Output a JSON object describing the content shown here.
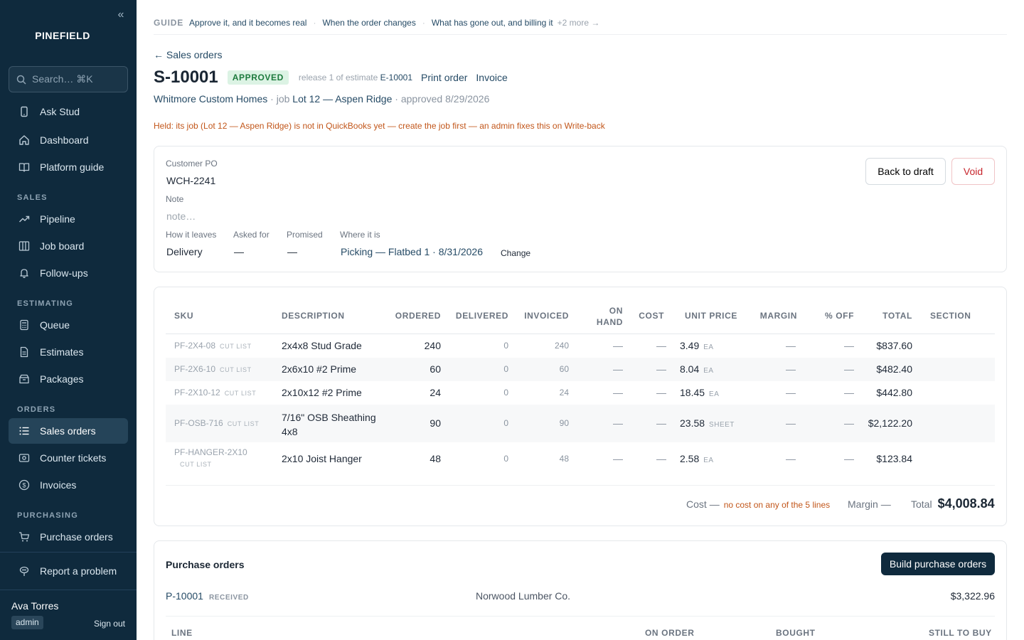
{
  "sidebar": {
    "brand": "PINEFIELD",
    "search_placeholder": "Search…  ⌘K",
    "items_top": [
      {
        "label": "Ask Stud",
        "icon": "phone-icon"
      },
      {
        "label": "Dashboard",
        "icon": "home-icon"
      },
      {
        "label": "Platform guide",
        "icon": "book-icon"
      }
    ],
    "sections": [
      {
        "title": "SALES",
        "items": [
          {
            "label": "Pipeline",
            "icon": "trend-icon"
          },
          {
            "label": "Job board",
            "icon": "columns-icon"
          },
          {
            "label": "Follow-ups",
            "icon": "bell-icon"
          }
        ]
      },
      {
        "title": "ESTIMATING",
        "items": [
          {
            "label": "Queue",
            "icon": "calculator-icon"
          },
          {
            "label": "Estimates",
            "icon": "document-icon"
          },
          {
            "label": "Packages",
            "icon": "package-icon"
          }
        ]
      },
      {
        "title": "ORDERS",
        "items": [
          {
            "label": "Sales orders",
            "icon": "list-icon",
            "active": true
          },
          {
            "label": "Counter tickets",
            "icon": "ticket-icon"
          },
          {
            "label": "Invoices",
            "icon": "dollar-icon"
          }
        ]
      },
      {
        "title": "PURCHASING",
        "items": [
          {
            "label": "Purchase orders",
            "icon": "cart-icon"
          }
        ]
      }
    ],
    "report_problem": "Report a problem",
    "user": {
      "name": "Ava Torres",
      "role": "admin",
      "signout": "Sign out"
    }
  },
  "guide": {
    "label": "GUIDE",
    "links": [
      "Approve it, and it becomes real",
      "When the order changes",
      "What has gone out, and billing it"
    ],
    "more": "+2 more →"
  },
  "header": {
    "back": "← Sales orders",
    "order_no": "S-10001",
    "status": "APPROVED",
    "release_prefix": "release 1 of estimate",
    "estimate_no": "E-10001",
    "print": "Print order",
    "invoice": "Invoice",
    "customer": "Whitmore Custom Homes",
    "job_prefix": "· job",
    "job": "Lot 12 — Aspen Ridge",
    "approved": "· approved 8/29/2026",
    "warning": "Held: its job (Lot 12 — Aspen Ridge) is not in QuickBooks yet — create the job first — an admin fixes this on Write-back"
  },
  "details": {
    "customer_po_label": "Customer PO",
    "customer_po": "WCH-2241",
    "note_label": "Note",
    "note_placeholder": "note…",
    "how_label": "How it leaves",
    "how": "Delivery",
    "asked_label": "Asked for",
    "asked": "—",
    "promised_label": "Promised",
    "promised": "—",
    "where_label": "Where it is",
    "where": "Picking — Flatbed 1 · 8/31/2026",
    "change": "Change",
    "back_to_draft": "Back to draft",
    "void": "Void"
  },
  "lines": {
    "headers": {
      "sku": "SKU",
      "description": "DESCRIPTION",
      "ordered": "ORDERED",
      "delivered": "DELIVERED",
      "invoiced": "INVOICED",
      "on_hand_1": "ON",
      "on_hand_2": "HAND",
      "cost": "COST",
      "unit_price": "UNIT PRICE",
      "margin": "MARGIN",
      "pct_off": "% OFF",
      "total": "TOTAL",
      "section": "SECTION"
    },
    "rows": [
      {
        "sku": "PF-2X4-08",
        "tag": "CUT LIST",
        "desc": "2x4x8 Stud Grade",
        "ordered": "240",
        "delivered": "0",
        "invoiced": "240",
        "on_hand": "—",
        "cost": "—",
        "price": "3.49",
        "unit": "EA",
        "margin": "—",
        "off": "—",
        "total": "$837.60"
      },
      {
        "sku": "PF-2X6-10",
        "tag": "CUT LIST",
        "desc": "2x6x10 #2 Prime",
        "ordered": "60",
        "delivered": "0",
        "invoiced": "60",
        "on_hand": "—",
        "cost": "—",
        "price": "8.04",
        "unit": "EA",
        "margin": "—",
        "off": "—",
        "total": "$482.40"
      },
      {
        "sku": "PF-2X10-12",
        "tag": "CUT LIST",
        "desc": "2x10x12 #2 Prime",
        "ordered": "24",
        "delivered": "0",
        "invoiced": "24",
        "on_hand": "—",
        "cost": "—",
        "price": "18.45",
        "unit": "EA",
        "margin": "—",
        "off": "—",
        "total": "$442.80"
      },
      {
        "sku": "PF-OSB-716",
        "tag": "CUT LIST",
        "desc_1": "7/16\" OSB Sheathing",
        "desc_2": "4x8",
        "ordered": "90",
        "delivered": "0",
        "invoiced": "90",
        "on_hand": "—",
        "cost": "—",
        "price": "23.58",
        "unit": "SHEET",
        "margin": "—",
        "off": "—",
        "total": "$2,122.20"
      },
      {
        "sku": "PF-HANGER-2X10",
        "tag": "CUT LIST",
        "desc": "2x10 Joist Hanger",
        "ordered": "48",
        "delivered": "0",
        "invoiced": "48",
        "on_hand": "—",
        "cost": "—",
        "price": "2.58",
        "unit": "EA",
        "margin": "—",
        "off": "—",
        "total": "$123.84"
      }
    ],
    "footer": {
      "cost_label": "Cost",
      "cost": "—",
      "cost_note": "no cost on any of the 5 lines",
      "margin_label": "Margin",
      "margin": "—",
      "total_label": "Total",
      "total": "$4,008.84"
    }
  },
  "purchase_orders": {
    "title": "Purchase orders",
    "build_button": "Build purchase orders",
    "po_no": "P-10001",
    "po_status": "RECEIVED",
    "vendor": "Norwood Lumber Co.",
    "amount": "$3,322.96",
    "headers": {
      "line": "LINE",
      "on_order": "ON ORDER",
      "bought": "BOUGHT",
      "still_to_buy": "STILL TO BUY"
    }
  }
}
